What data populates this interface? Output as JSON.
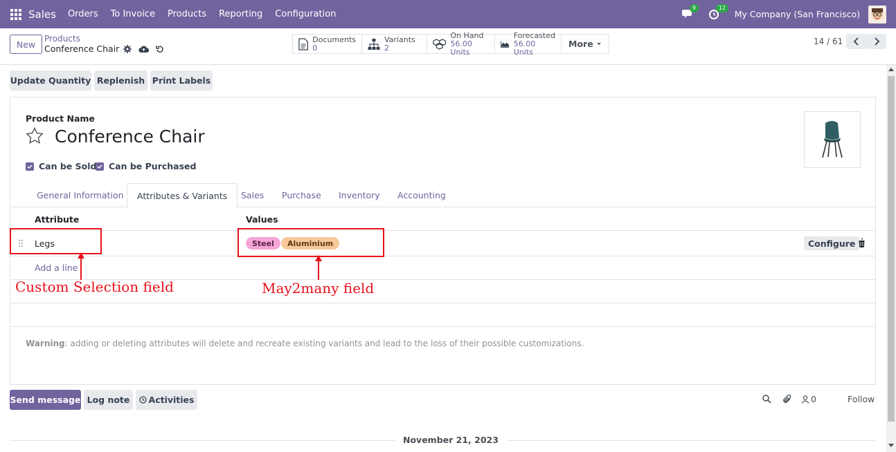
{
  "navbar": {
    "app_name": "Sales",
    "menu": [
      "Orders",
      "To Invoice",
      "Products",
      "Reporting",
      "Configuration"
    ],
    "messages_count": "9",
    "activities_count": "12",
    "company": "My Company (San Francisco)",
    "bg_color": "#71639e"
  },
  "control": {
    "new_label": "New",
    "breadcrumb_parent": "Products",
    "breadcrumb_current": "Conference Chair",
    "smart_buttons": [
      {
        "label": "Documents",
        "value": "0",
        "icon": "document-icon"
      },
      {
        "label": "Variants",
        "value": "2",
        "icon": "sitemap-icon"
      },
      {
        "label": "On Hand",
        "value": "56.00 Units",
        "icon": "cubes-icon"
      },
      {
        "label": "Forecasted",
        "value": "56.00 Units",
        "icon": "area-chart-icon"
      }
    ],
    "more_label": "More",
    "pager": "14 / 61"
  },
  "actions": {
    "update_quantity": "Update Quantity",
    "replenish": "Replenish",
    "print_labels": "Print Labels"
  },
  "form": {
    "product_name_label": "Product Name",
    "product_name": "Conference Chair",
    "can_be_sold": "Can be Sold",
    "can_be_purchased": "Can be Purchased",
    "tabs": [
      "General Information",
      "Attributes & Variants",
      "Sales",
      "Purchase",
      "Inventory",
      "Accounting"
    ],
    "active_tab": "Attributes & Variants",
    "table": {
      "col_attribute": "Attribute",
      "col_values": "Values",
      "rows": [
        {
          "attribute": "Legs",
          "values": [
            "Steel",
            "Aluminium"
          ],
          "action": "Configure"
        }
      ],
      "add_line": "Add a line"
    },
    "warning_title": "Warning",
    "warning_text": ": adding or deleting attributes will delete and recreate existing variants and lead to the loss of their possible customizations."
  },
  "annotations": {
    "left": "Custom Selection field",
    "right": "May2many field",
    "color": "#e8111b"
  },
  "chatter": {
    "send_message": "Send message",
    "log_note": "Log note",
    "activities": "Activities",
    "followers_count": "0",
    "follow": "Follow",
    "date": "November 21, 2023"
  },
  "tag_colors": {
    "Steel": "#f4a6d7",
    "Aluminium": "#f7c99a"
  }
}
